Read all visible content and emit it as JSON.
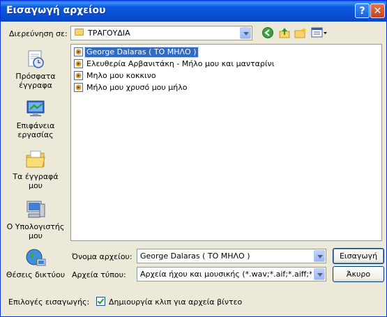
{
  "window": {
    "title": "Εισαγωγή αρχείου",
    "help_label": "?",
    "close_label": "✕"
  },
  "lookin": {
    "label": "Διερεύνηση σε:",
    "value": "ΤΡΑΓΟΥΔΙΑ"
  },
  "toolbar": {
    "icons": [
      "back-icon",
      "up-folder-icon",
      "new-folder-icon",
      "views-menu-icon"
    ]
  },
  "places": [
    {
      "label": "Πρόσφατα έγγραφα",
      "icon": "recent-documents-icon"
    },
    {
      "label": "Επιφάνεια εργασίας",
      "icon": "desktop-icon"
    },
    {
      "label": "Τα έγγραφά μου",
      "icon": "my-documents-icon"
    },
    {
      "label": "Ο Υπολογιστής μου",
      "icon": "my-computer-icon"
    },
    {
      "label": "Θέσεις δικτύου",
      "icon": "network-places-icon"
    }
  ],
  "files": [
    {
      "name": "George Dalaras ( ΤΟ ΜΗΛΟ )",
      "selected": true
    },
    {
      "name": "Ελευθερία Αρβανιτάκη - Μήλο μου και μανταρίνι",
      "selected": false
    },
    {
      "name": "Μηλο μου κοκκινο",
      "selected": false
    },
    {
      "name": "Μήλο μου χρυσό μου μήλο",
      "selected": false
    }
  ],
  "filename": {
    "label": "Όνομα αρχείου:",
    "value": "George Dalaras ( ΤΟ ΜΗΛΟ )"
  },
  "filetype": {
    "label": "Αρχεία τύπου:",
    "value": "Αρχεία ήχου και μουσικής (*.wav;*.aif;*.aiff;*.aifc;*.s"
  },
  "buttons": {
    "import": "Εισαγωγή",
    "cancel": "Άκυρο"
  },
  "options": {
    "label": "Επιλογές εισαγωγής:",
    "checkbox_label": "Δημιουργία κλιπ για αρχεία βίντεο",
    "checked": true
  },
  "colors": {
    "titlebar": "#0a5bde",
    "selection": "#316ac5",
    "dialog_bg": "#ece9d8"
  }
}
